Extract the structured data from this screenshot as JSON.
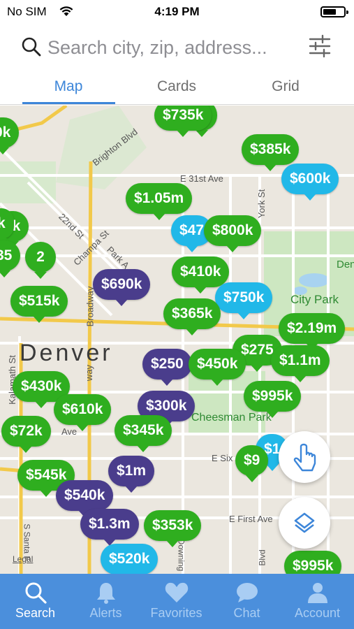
{
  "status": {
    "carrier": "No SIM",
    "time": "4:19 PM"
  },
  "search": {
    "placeholder": "Search city, zip, address..."
  },
  "tabs": [
    {
      "label": "Map",
      "active": true
    },
    {
      "label": "Cards",
      "active": false
    },
    {
      "label": "Grid",
      "active": false
    }
  ],
  "map": {
    "city_label": "Denver",
    "streets": [
      "Brighton Blvd",
      "E 31st Ave",
      "York St",
      "22nd St",
      "Champa St",
      "Park A",
      "Broadway",
      "City Park",
      "Den",
      "Kalamath St",
      "way",
      "Ave",
      "E Six",
      "E First Ave",
      "Cheesman Park",
      "S Santa F",
      "Downing",
      "Blvd",
      "Legal"
    ],
    "listings": [
      {
        "price": "$735k",
        "color": "green"
      },
      {
        "price": "m",
        "color": "green"
      },
      {
        "price": "0k",
        "color": "green"
      },
      {
        "price": "$385k",
        "color": "green"
      },
      {
        "price": "$600k",
        "color": "blue"
      },
      {
        "price": "$1.05m",
        "color": "green"
      },
      {
        "price": "k",
        "color": "green"
      },
      {
        "price": "0k",
        "color": "green"
      },
      {
        "price": "$47",
        "color": "blue"
      },
      {
        "price": "$800k",
        "color": "green"
      },
      {
        "price": "35",
        "color": "green"
      },
      {
        "price": "2",
        "color": "green"
      },
      {
        "price": "$410k",
        "color": "green"
      },
      {
        "price": "$690k",
        "color": "purple"
      },
      {
        "price": "$515k",
        "color": "green"
      },
      {
        "price": "$750k",
        "color": "blue"
      },
      {
        "price": "$365k",
        "color": "green"
      },
      {
        "price": "$2.19m",
        "color": "green"
      },
      {
        "price": "$275",
        "color": "green"
      },
      {
        "price": "$250",
        "color": "purple"
      },
      {
        "price": "$450k",
        "color": "green"
      },
      {
        "price": "$1.1m",
        "color": "green"
      },
      {
        "price": "$430k",
        "color": "green"
      },
      {
        "price": "$995k",
        "color": "green"
      },
      {
        "price": "$610k",
        "color": "green"
      },
      {
        "price": "$300k",
        "color": "purple"
      },
      {
        "price": "$72k",
        "color": "green"
      },
      {
        "price": "$345k",
        "color": "green"
      },
      {
        "price": "$1",
        "color": "blue"
      },
      {
        "price": "$9",
        "color": "green"
      },
      {
        "price": "$545k",
        "color": "green"
      },
      {
        "price": "$1m",
        "color": "purple"
      },
      {
        "price": "$540k",
        "color": "purple"
      },
      {
        "price": "$1.3m",
        "color": "purple"
      },
      {
        "price": "$353k",
        "color": "green"
      },
      {
        "price": "$520k",
        "color": "blue"
      },
      {
        "price": "$995k",
        "color": "green"
      }
    ]
  },
  "bottom_nav": [
    {
      "label": "Search",
      "icon": "search-icon",
      "active": true
    },
    {
      "label": "Alerts",
      "icon": "bell-icon",
      "active": false
    },
    {
      "label": "Favorites",
      "icon": "heart-icon",
      "active": false
    },
    {
      "label": "Chat",
      "icon": "chat-bubble-icon",
      "active": false
    },
    {
      "label": "Account",
      "icon": "person-icon",
      "active": false
    }
  ],
  "colors": {
    "accent": "#3d86d9",
    "green_pin": "#2fae1f",
    "purple_pin": "#4a3d8c",
    "blue_pin": "#21b8e8",
    "tabbar": "#4b8fdc"
  }
}
